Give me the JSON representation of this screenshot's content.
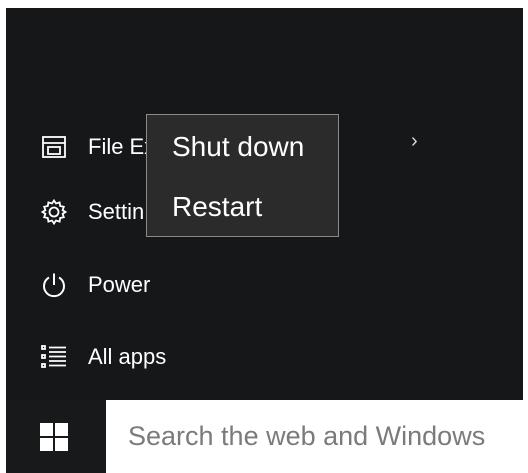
{
  "start_menu": {
    "items": [
      {
        "label": "File Ex",
        "icon": "file-explorer-icon",
        "has_submenu": true
      },
      {
        "label": "Settin",
        "icon": "settings-gear-icon"
      },
      {
        "label": "Power",
        "icon": "power-icon"
      },
      {
        "label": "All apps",
        "icon": "all-apps-list-icon"
      }
    ],
    "chevron": "›"
  },
  "power_menu": {
    "items": [
      {
        "label": "Shut down"
      },
      {
        "label": "Restart"
      }
    ]
  },
  "taskbar": {
    "start_icon": "windows-logo-icon",
    "search_placeholder": "Search the web and Windows"
  },
  "colors": {
    "menu_background": "#151719",
    "context_background": "#2b2b2b",
    "context_border": "#8a8a8a",
    "text": "#ffffff",
    "search_text": "#7b7b7b"
  }
}
